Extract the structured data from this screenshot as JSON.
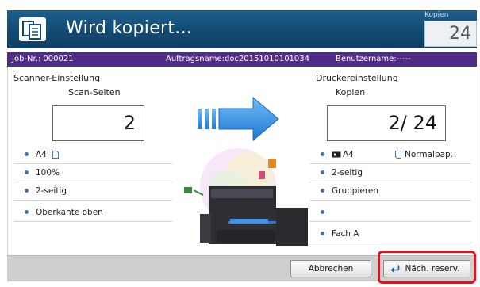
{
  "header": {
    "title": "Wird kopiert...",
    "copies_label": "Kopien",
    "copies_value": "24"
  },
  "jobbar": {
    "job_no": "Job-Nr.:   000021",
    "job_name": "Auftragsname:doc20151010101034",
    "user": "Benutzername:-----"
  },
  "scanner": {
    "title": "Scanner-Einstellung",
    "pages_label": "Scan-Seiten",
    "pages_value": "2",
    "settings": [
      "A4",
      "100%",
      "2-seitig",
      "Oberkante oben"
    ]
  },
  "printer": {
    "title": "Druckereinstellung",
    "copies_label": "Kopien",
    "copies_value": "2/  24",
    "paper_size": "A4",
    "paper_type": "Normalpap.",
    "settings": [
      "2-seitig",
      "Gruppieren",
      "",
      "Fach A"
    ]
  },
  "footer": {
    "cancel_label": "Abbrechen",
    "reserve_label": "Näch. reserv."
  },
  "colors": {
    "title_bar": "#134a72",
    "job_bar": "#4f2c86",
    "arrow": "#2a8de4",
    "highlight": "#e0141d"
  }
}
